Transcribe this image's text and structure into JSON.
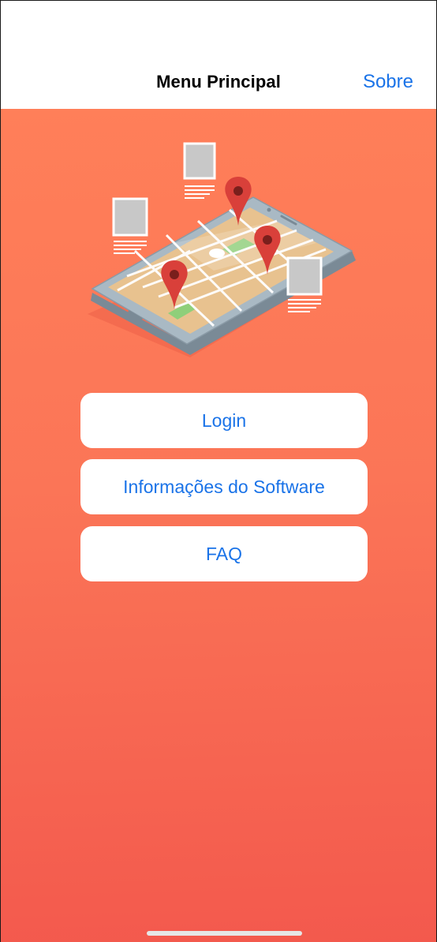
{
  "navbar": {
    "title": "Menu Principal",
    "action_label": "Sobre"
  },
  "menu": {
    "buttons": [
      {
        "label": "Login"
      },
      {
        "label": "Informações do Software"
      },
      {
        "label": "FAQ"
      }
    ]
  },
  "illustration": {
    "icon": "phone-map-with-location-pins-illustration"
  },
  "colors": {
    "accent": "#1a73e8",
    "background_top": "#ff7f59",
    "background_bottom": "#f3594d",
    "pin": "#d9403a"
  }
}
